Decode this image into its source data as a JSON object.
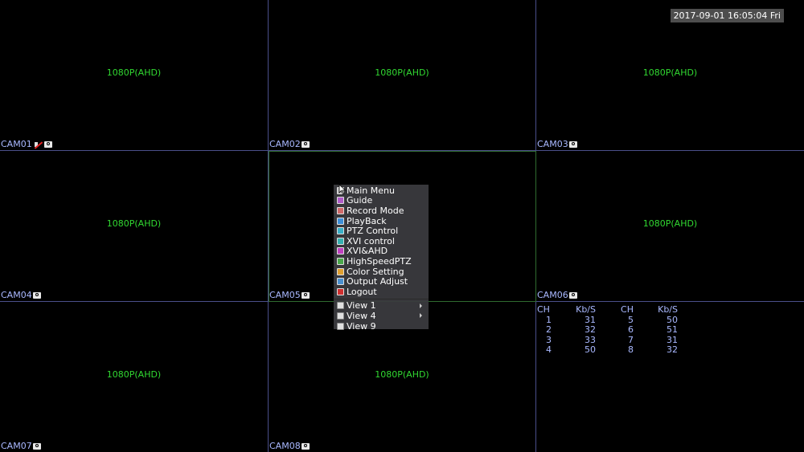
{
  "clock": "2017-09-01 16:05:04 Fri",
  "cameras": [
    {
      "name": "CAM01",
      "res": "1080P(AHD)",
      "mute": true
    },
    {
      "name": "CAM02",
      "res": "1080P(AHD)",
      "mute": false
    },
    {
      "name": "CAM03",
      "res": "1080P(AHD)",
      "mute": false
    },
    {
      "name": "CAM04",
      "res": "1080P(AHD)",
      "mute": false
    },
    {
      "name": "CAM05",
      "res": "",
      "mute": false
    },
    {
      "name": "CAM06",
      "res": "1080P(AHD)",
      "mute": false
    },
    {
      "name": "CAM07",
      "res": "1080P(AHD)",
      "mute": false
    },
    {
      "name": "CAM08",
      "res": "1080P(AHD)",
      "mute": false
    }
  ],
  "menu": {
    "items": [
      {
        "label": "Main Menu",
        "icon": "home-icon",
        "color": "#c0c0c0"
      },
      {
        "label": "Guide",
        "icon": "guide-icon",
        "color": "#b05cc8"
      },
      {
        "label": "Record Mode",
        "icon": "record-icon",
        "color": "#d06a6a"
      },
      {
        "label": "PlayBack",
        "icon": "playback-icon",
        "color": "#3d8fd8"
      },
      {
        "label": "PTZ Control",
        "icon": "ptz-icon",
        "color": "#3ab0c8"
      },
      {
        "label": "XVI control",
        "icon": "xvi-icon",
        "color": "#36b0b0"
      },
      {
        "label": "XVI&AHD",
        "icon": "xvi-ahd-icon",
        "color": "#c040c0"
      },
      {
        "label": "HighSpeedPTZ",
        "icon": "highspeed-ptz-icon",
        "color": "#4aa84a"
      },
      {
        "label": "Color Setting",
        "icon": "color-setting-icon",
        "color": "#e0a030"
      },
      {
        "label": "Output Adjust",
        "icon": "output-adjust-icon",
        "color": "#4a90d0"
      },
      {
        "label": "Logout",
        "icon": "logout-icon",
        "color": "#d03030"
      }
    ],
    "views": [
      {
        "label": "View 1",
        "icon": "view-1-icon",
        "submenu": true
      },
      {
        "label": "View 4",
        "icon": "view-4-icon",
        "submenu": true
      },
      {
        "label": "View 9",
        "icon": "view-9-icon",
        "submenu": false
      }
    ]
  },
  "stats": {
    "headers": [
      "CH",
      "Kb/S",
      "CH",
      "Kb/S"
    ],
    "rows": [
      [
        "1",
        "31",
        "5",
        "50"
      ],
      [
        "2",
        "32",
        "6",
        "51"
      ],
      [
        "3",
        "33",
        "7",
        "31"
      ],
      [
        "4",
        "50",
        "8",
        "32"
      ]
    ]
  }
}
